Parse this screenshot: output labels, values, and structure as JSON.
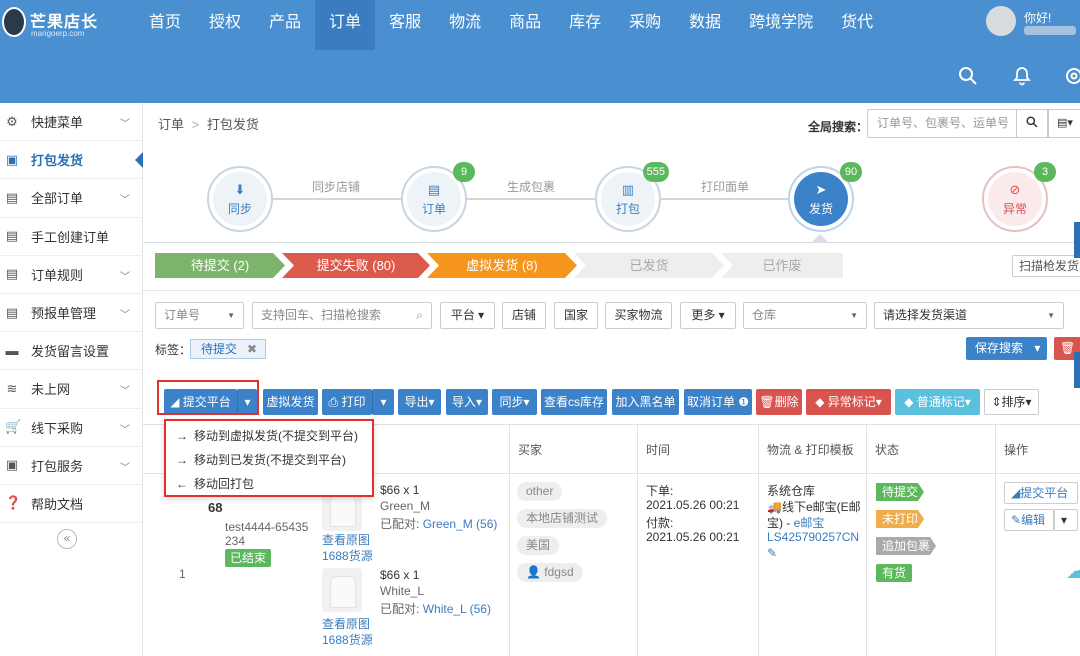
{
  "brand": {
    "name": "芒果店长",
    "domain": "mangoerp.com"
  },
  "topnav": [
    "首页",
    "授权",
    "产品",
    "订单",
    "客服",
    "物流",
    "商品",
    "库存",
    "采购",
    "数据",
    "跨境学院",
    "货代"
  ],
  "topnav_active": "订单",
  "user": {
    "greeting": "你好!"
  },
  "toolbar_icons": [
    "search-icon",
    "bell-icon",
    "settings-icon"
  ],
  "sidebar": {
    "items": [
      {
        "label": "快捷菜单",
        "icon": "gear-icon",
        "chevron": true
      },
      {
        "label": "打包发货",
        "icon": "package-icon",
        "active": true
      },
      {
        "label": "全部订单",
        "icon": "clipboard-icon",
        "chevron": true
      },
      {
        "label": "手工创建订单",
        "icon": "edit-doc-icon"
      },
      {
        "label": "订单规则",
        "icon": "rules-icon",
        "chevron": true
      },
      {
        "label": "预报单管理",
        "icon": "doc-icon",
        "chevron": true
      },
      {
        "label": "发货留言设置",
        "icon": "comment-icon"
      },
      {
        "label": "未上网",
        "icon": "wifi-icon",
        "chevron": true
      },
      {
        "label": "线下采购",
        "icon": "cart-icon",
        "chevron": true
      },
      {
        "label": "打包服务",
        "icon": "package-icon",
        "chevron": true
      },
      {
        "label": "帮助文档",
        "icon": "help-icon"
      }
    ],
    "collapse_label": "«"
  },
  "breadcrumb": {
    "root": "订单",
    "sep": ">",
    "current": "打包发货"
  },
  "global_search": {
    "label": "全局搜索：",
    "placeholder": "订单号、包裹号、运单号"
  },
  "flow": {
    "steps": [
      {
        "label": "同步",
        "icon": "download-icon"
      },
      {
        "label": "订单",
        "icon": "order-icon",
        "badge": "9"
      },
      {
        "label": "打包",
        "icon": "barcode-icon",
        "badge": "555"
      },
      {
        "label": "发货",
        "icon": "send-icon",
        "badge": "90",
        "active": true
      },
      {
        "label": "异常",
        "icon": "eye-off-icon",
        "badge": "3"
      }
    ],
    "connectors": [
      "同步店铺",
      "生成包裹",
      "打印面单"
    ]
  },
  "status_tabs": [
    "待提交 (2)",
    "提交失败 (80)",
    "虚拟发货 (8)",
    "已发货",
    "已作废"
  ],
  "scan_button": "扫描枪发货",
  "filters": {
    "order_no": "订单号",
    "search_placeholder": "支持回车、扫描枪搜索",
    "platform": "平台",
    "shop": "店铺",
    "country": "国家",
    "buyer_logistics": "买家物流",
    "more": "更多",
    "warehouse": "仓库",
    "channel": "请选择发货渠道"
  },
  "tags": {
    "label": "标签：",
    "chip": "待提交",
    "save": "保存搜索",
    "clear": "清"
  },
  "actions": {
    "submit": "提交平台",
    "virtual": "虚拟发货",
    "print": "打印",
    "export": "导出",
    "import": "导入",
    "sync": "同步",
    "cs_stock": "查看cs库存",
    "blacklist": "加入黑名单",
    "cancel": "取消订单",
    "delete": "删除",
    "abnormal": "异常标记",
    "normal": "普通标记",
    "sort": "排序"
  },
  "dropdown": [
    {
      "label": "移动到虚拟发货(不提交到平台)",
      "arrow": "→"
    },
    {
      "label": "移动到已发货(不提交到平台)",
      "arrow": "→"
    },
    {
      "label": "移动回打包",
      "arrow": "←"
    }
  ],
  "table": {
    "headers": [
      "买家",
      "时间",
      "物流 & 打印模板",
      "状态",
      "操作"
    ],
    "row": {
      "index": "1",
      "order_no_tail": "68",
      "order_id": "test4444-65435",
      "order_id_cont": "234",
      "order_status": "已结束",
      "items": [
        {
          "price": "$66 x 1",
          "sku": "Green_M",
          "matched_label": "已配对:",
          "matched": "Green_M (56)",
          "view": "查看原图",
          "source": "1688货源"
        },
        {
          "price": "$66 x 1",
          "sku": "White_L",
          "matched_label": "已配对:",
          "matched": "White_L (56)",
          "view": "查看原图",
          "source": "1688货源"
        }
      ],
      "buyer_tags": [
        "other",
        "本地店铺测试",
        "美国",
        "fdgsd"
      ],
      "time": {
        "order_label": "下单:",
        "order": "2021.05.26 00:21",
        "pay_label": "付款:",
        "pay": "2021.05.26 00:21"
      },
      "logistics": {
        "warehouse": "系统仓库",
        "line1": "线下e邮宝(E邮",
        "line2": "宝) -",
        "line2_link": "e邮宝",
        "tracking": "LS425790257CN"
      },
      "status_tags": [
        {
          "label": "待提交",
          "color": "#5cb85c"
        },
        {
          "label": "未打印",
          "color": "#f0ad4e"
        },
        {
          "label": "追加包裹",
          "color": "#aaaaaa"
        },
        {
          "label": "有货",
          "color": "#5cb85c"
        }
      ],
      "ops": {
        "submit": "提交平台",
        "edit": "编辑"
      }
    }
  }
}
